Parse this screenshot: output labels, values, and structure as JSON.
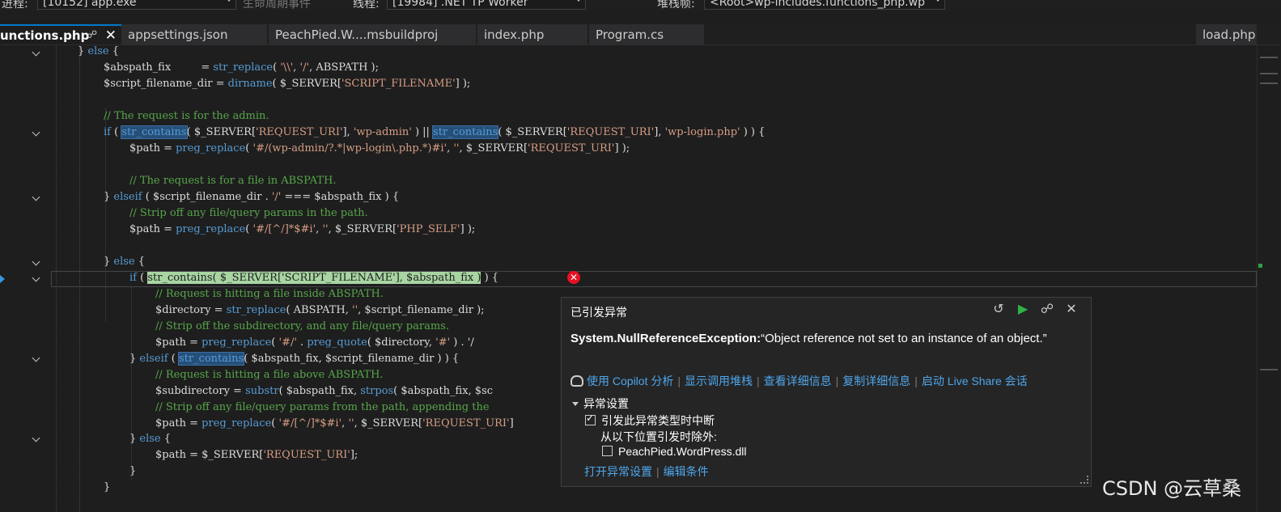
{
  "topbar": {
    "process_label": "进程:",
    "process_value": "[10152] app.exe",
    "lifecycle_label": "生命周期事件",
    "thread_label": "线程:",
    "thread_value": "[19984] .NET TP Worker",
    "stack_label": "堆栈帧:",
    "stack_value": "<Root>wp-includes.functions_php.wp"
  },
  "tabs": [
    {
      "label": "unctions.php",
      "active": true
    },
    {
      "label": "appsettings.json"
    },
    {
      "label": "PeachPied.W....msbuildproj"
    },
    {
      "label": "index.php"
    },
    {
      "label": "Program.cs"
    },
    {
      "label": "load.php"
    }
  ],
  "code": {
    "l01_a": "} ",
    "l01_b": "else",
    "l01_c": " {",
    "l02_a": "$abspath_fix         = ",
    "l02_fn": "str_replace",
    "l02_b": "( ",
    "l02_s1": "'\\\\'",
    "l02_c": ", ",
    "l02_s2": "'/'",
    "l02_d": ", ABSPATH );",
    "l03_a": "$script_filename_dir = ",
    "l03_fn": "dirname",
    "l03_b": "( $_SERVER[",
    "l03_s": "'SCRIPT_FILENAME'",
    "l03_c": "] );",
    "l05": "// The request is for the admin.",
    "l06_if": "if",
    "l06_a": " ( ",
    "l06_fn1": "str_contains",
    "l06_b": "( $_SERVER[",
    "l06_s1": "'REQUEST_URI'",
    "l06_c": "], ",
    "l06_s2": "'wp-admin'",
    "l06_d": " ) || ",
    "l06_fn2": "str_contains",
    "l06_e": "( $_SERVER[",
    "l06_s3": "'REQUEST_URI'",
    "l06_f": "], ",
    "l06_s4": "'wp-login.php'",
    "l06_g": " ) ) {",
    "l07_a": "$path = ",
    "l07_fn": "preg_replace",
    "l07_b": "( ",
    "l07_s1": "'#/(wp-admin/?.*|wp-login\\.php.*)#i'",
    "l07_c": ", ",
    "l07_s2": "''",
    "l07_d": ", $_SERVER[",
    "l07_s3": "'REQUEST_URI'",
    "l07_e": "] );",
    "l09": "// The request is for a file in ABSPATH.",
    "l10_a": "} ",
    "l10_kw": "elseif",
    "l10_b": " ( $script_filename_dir . ",
    "l10_s": "'/'",
    "l10_c": " === $abspath_fix ) {",
    "l11": "// Strip off any file/query params in the path.",
    "l12_a": "$path = ",
    "l12_fn": "preg_replace",
    "l12_b": "( ",
    "l12_s1": "'#/[^/]*$#i'",
    "l12_c": ", ",
    "l12_s2": "''",
    "l12_d": ", $_SERVER[",
    "l12_s3": "'PHP_SELF'",
    "l12_e": "] );",
    "l14_a": "} ",
    "l14_kw": "else",
    "l14_b": " {",
    "l15_if": "if",
    "l15_a": " ( ",
    "l15_hl": "str_contains( $_SERVER['SCRIPT_FILENAME'], $abspath_fix )",
    "l15_b": " ) {",
    "l16": "// Request is hitting a file inside ABSPATH.",
    "l17_a": "$directory = ",
    "l17_fn": "str_replace",
    "l17_b": "( ABSPATH, ",
    "l17_s": "''",
    "l17_c": ", $script_filename_dir );",
    "l18": "// Strip off the subdirectory, and any file/query params.",
    "l19_a": "$path = ",
    "l19_fn": "preg_replace",
    "l19_b": "( ",
    "l19_s1": "'#/'",
    "l19_c": " . ",
    "l19_fn2": "preg_quote",
    "l19_d": "( $directory, ",
    "l19_s2": "'#'",
    "l19_e": " ) . '/",
    "l20_a": "} ",
    "l20_kw": "elseif",
    "l20_b": " ( ",
    "l20_fn": "str_contains",
    "l20_c": "( $abspath_fix, $script_filename_dir ) ) {",
    "l21": "// Request is hitting a file above ABSPATH.",
    "l22_a": "$subdirectory = ",
    "l22_fn": "substr",
    "l22_b": "( $abspath_fix, ",
    "l22_fn2": "strpos",
    "l22_c": "( $abspath_fix, $sc",
    "l23": "// Strip off any file/query params from the path, appending the",
    "l24_a": "$path = ",
    "l24_fn": "preg_replace",
    "l24_b": "( ",
    "l24_s1": "'#/[^/]*$#i'",
    "l24_c": ", ",
    "l24_s2": "''",
    "l24_d": ", $_SERVER[",
    "l24_s3": "'REQUEST_URI'",
    "l24_e": "]",
    "l25_a": "} ",
    "l25_kw": "else",
    "l25_b": " {",
    "l26_a": "$path = $_SERVER[",
    "l26_s": "'REQUEST_URI'",
    "l26_b": "];",
    "l27": "}",
    "l28": "}"
  },
  "popup": {
    "title": "已引发异常",
    "exception_type": "System.NullReferenceException:",
    "exception_message": "“Object reference not set to an instance of an object.”",
    "links": [
      "使用 Copilot 分析",
      "显示调用堆栈",
      "查看详细信息",
      "复制详细信息",
      "启动 Live Share 会话"
    ],
    "settings_header": "异常设置",
    "break_when_thrown": "引发此异常类型时中断",
    "break_checked": true,
    "except_when_from": "从以下位置引发时除外:",
    "module": "PeachPied.WordPress.dll",
    "module_checked": false,
    "bottom_links": [
      "打开异常设置",
      "编辑条件"
    ]
  },
  "watermark": "CSDN @云草桑"
}
